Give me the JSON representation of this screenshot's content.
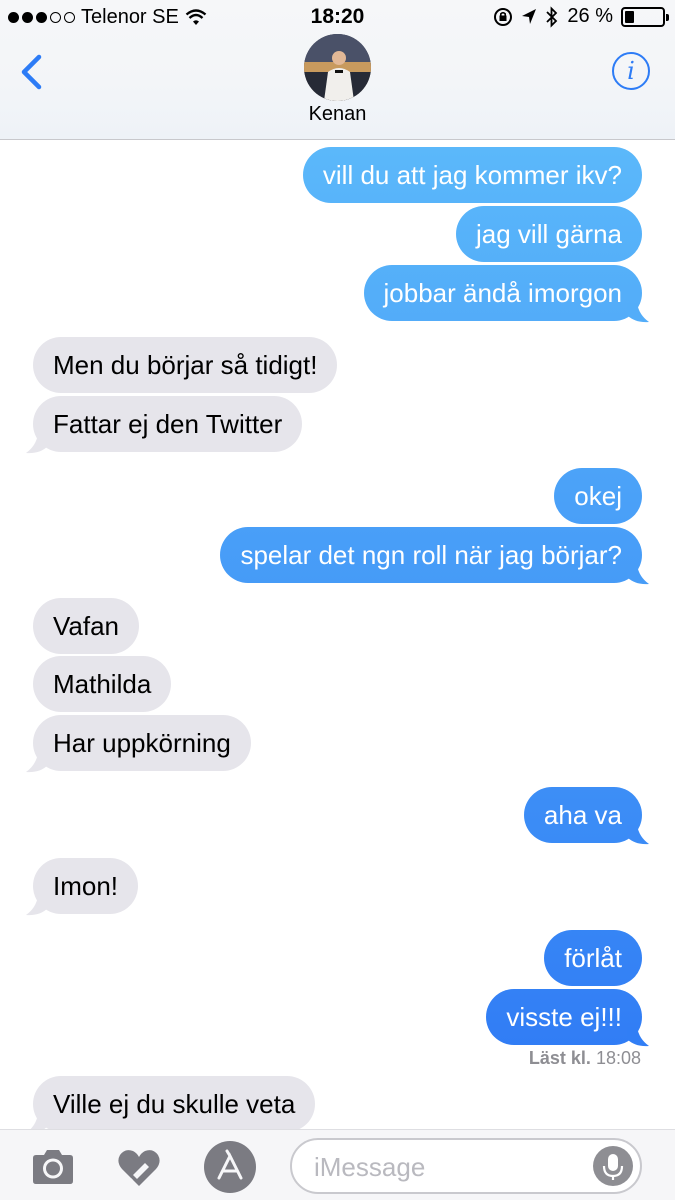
{
  "status_bar": {
    "carrier": "Telenor SE",
    "time": "18:20",
    "battery": "26 %",
    "battery_level": 0.26
  },
  "header": {
    "contact_name": "Kenan",
    "back_icon": "chevron-left-icon",
    "info_icon": "info-icon",
    "accent": "#2d7cf6"
  },
  "messages": [
    {
      "dir": "out",
      "text": "vill du att jag kommer ikv?"
    },
    {
      "dir": "out",
      "text": "jag vill gärna"
    },
    {
      "dir": "out",
      "text": "jobbar ändå imorgon"
    },
    {
      "dir": "in",
      "text": "Men du börjar så tidigt!"
    },
    {
      "dir": "in",
      "text": "Fattar ej den Twitter"
    },
    {
      "dir": "out",
      "text": "okej"
    },
    {
      "dir": "out",
      "text": "spelar det ngn roll när jag börjar?"
    },
    {
      "dir": "in",
      "text": "Vafan"
    },
    {
      "dir": "in",
      "text": "Mathilda"
    },
    {
      "dir": "in",
      "text": "Har uppkörning"
    },
    {
      "dir": "out",
      "text": "aha va"
    },
    {
      "dir": "in",
      "text": "Imon!"
    },
    {
      "dir": "out",
      "text": "förlåt"
    },
    {
      "dir": "out",
      "text": "visste ej!!!"
    },
    {
      "dir": "in",
      "text": "Ville ej du skulle veta"
    }
  ],
  "read_receipt": {
    "label": "Läst kl.",
    "time": "18:08"
  },
  "input_bar": {
    "placeholder": "iMessage",
    "icons": [
      "camera-icon",
      "digital-touch-heart-icon",
      "app-store-icon",
      "microphone-icon"
    ]
  },
  "colors": {
    "incoming_bubble": "#e6e5eb",
    "outgoing_top": "#5bb8fa",
    "outgoing_bottom": "#2d78f4"
  }
}
